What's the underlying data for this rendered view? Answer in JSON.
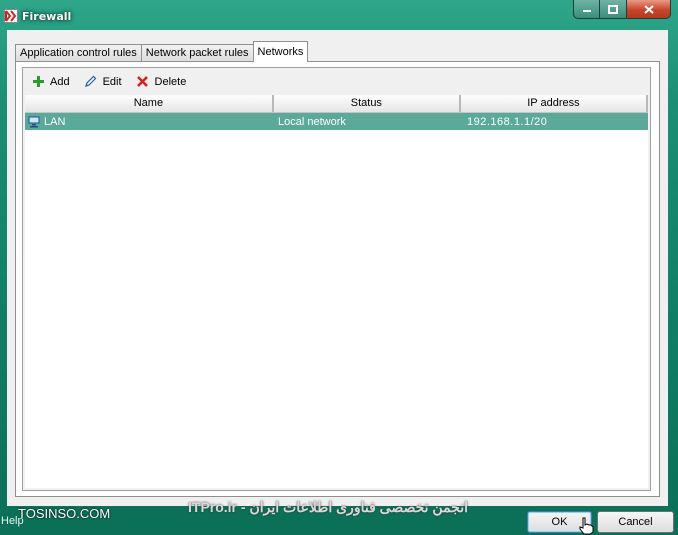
{
  "window": {
    "title": "Firewall"
  },
  "tabs": [
    {
      "label": "Application control rules"
    },
    {
      "label": "Network packet rules"
    },
    {
      "label": "Networks",
      "active": true
    }
  ],
  "toolbar": {
    "add_label": "Add",
    "edit_label": "Edit",
    "delete_label": "Delete"
  },
  "table": {
    "columns": [
      "Name",
      "Status",
      "IP address"
    ],
    "rows": [
      {
        "name": "LAN",
        "status": "Local network",
        "ip": "192.168.1.1/20",
        "selected": true
      }
    ]
  },
  "footer": {
    "help_label": "Help",
    "ok_label": "OK",
    "cancel_label": "Cancel"
  },
  "watermarks": {
    "site": "TOSINSO.COM",
    "brand": "ITPro.ir - انجمن تخصصی فناوری اطلاعات ایران"
  },
  "colors": {
    "window_frame": "#1c8f74",
    "selection": "#5aa99b",
    "close_button": "#c7452c"
  }
}
